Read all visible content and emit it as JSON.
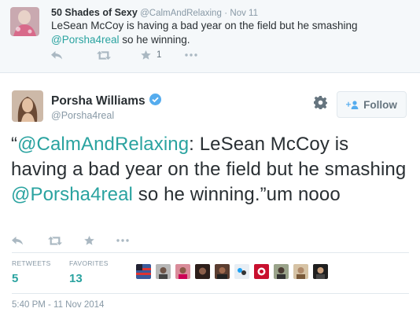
{
  "quoted_tweet": {
    "name": "50 Shades of Sexy",
    "handle": "@CalmAndRelaxing",
    "separator": "·",
    "time": "Nov 11",
    "text_before": "LeSean McCoy is having a bad year on the field but he smashing ",
    "mention": "@Porsha4real",
    "text_after": " so he winning.",
    "favorite_count": "1",
    "icons": [
      "reply-icon",
      "retweet-icon",
      "favorite-icon",
      "more-icon"
    ]
  },
  "main_tweet": {
    "name": "Porsha Williams",
    "handle": "@Porsha4real",
    "follow_label": "Follow",
    "text_parts": {
      "open_quote": "“",
      "mention1": "@CalmAndRelaxing",
      "mid1": ": LeSean McCoy is having a bad year on the field but he smashing ",
      "mention2": "@Porsha4real",
      "tail": " so he winning.”um nooo"
    },
    "retweets_label": "RETWEETS",
    "retweets_count": "5",
    "favorites_label": "FAVORITES",
    "favorites_count": "13",
    "timestamp": "5:40 PM - 11 Nov 2014",
    "icons": [
      "reply-icon",
      "retweet-icon",
      "favorite-icon",
      "more-icon",
      "gear-icon",
      "verified-icon",
      "follow-person-icon"
    ]
  },
  "colors": {
    "accent": "#2aa3a0",
    "muted": "#8899a6",
    "icon": "#aab8c2",
    "text": "#292f33",
    "quoted_bg": "#f5f8fa",
    "verified": "#55acee"
  }
}
